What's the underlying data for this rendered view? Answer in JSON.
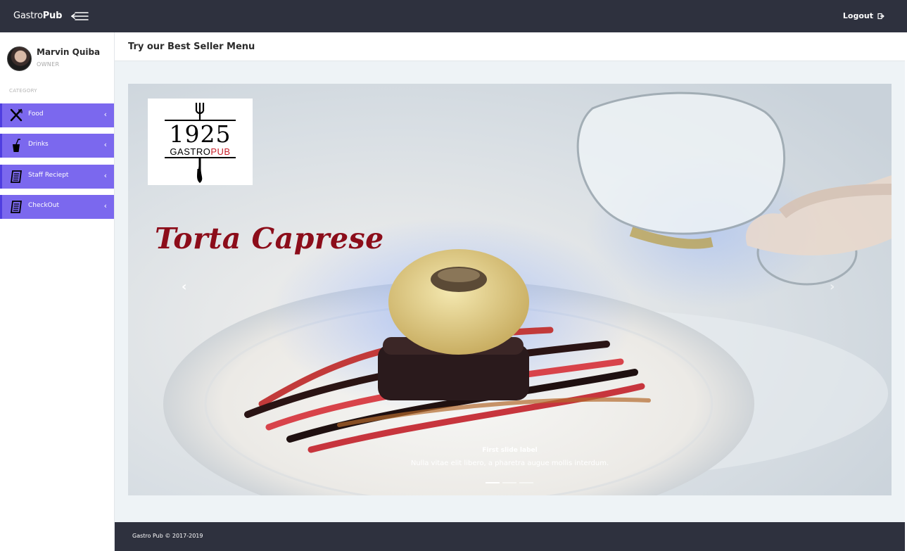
{
  "topbar": {
    "brand_light": "Gastro",
    "brand_bold": "Pub",
    "logout_label": "Logout"
  },
  "user": {
    "name": "Marvin Quiba",
    "role": "OWNER"
  },
  "sidebar": {
    "category_label": "CATEGORY",
    "items": [
      {
        "label": "Food",
        "icon": "fork-knife-icon"
      },
      {
        "label": "Drinks",
        "icon": "drink-cup-icon"
      },
      {
        "label": "Staff Reciept",
        "icon": "receipt-icon"
      },
      {
        "label": "CheckOut",
        "icon": "receipt-icon"
      }
    ]
  },
  "main": {
    "title": "Try our Best Seller Menu"
  },
  "carousel": {
    "logo_number": "1925",
    "logo_text_dark": "GASTRO",
    "logo_text_red": "PUB",
    "slide_heading": "Torta Caprese",
    "caption_title": "First slide label",
    "caption_text": "Nulla vitae elit libero, a pharetra augue mollis interdum.",
    "active_slide": 1,
    "slide_count": 3
  },
  "footer": {
    "text": "Gastro Pub © 2017-2019"
  },
  "colors": {
    "topbar": "#2e313e",
    "nav_item": "#7b68ee",
    "heading_red": "#8c0d1a",
    "content_bg": "#eef3f6"
  }
}
